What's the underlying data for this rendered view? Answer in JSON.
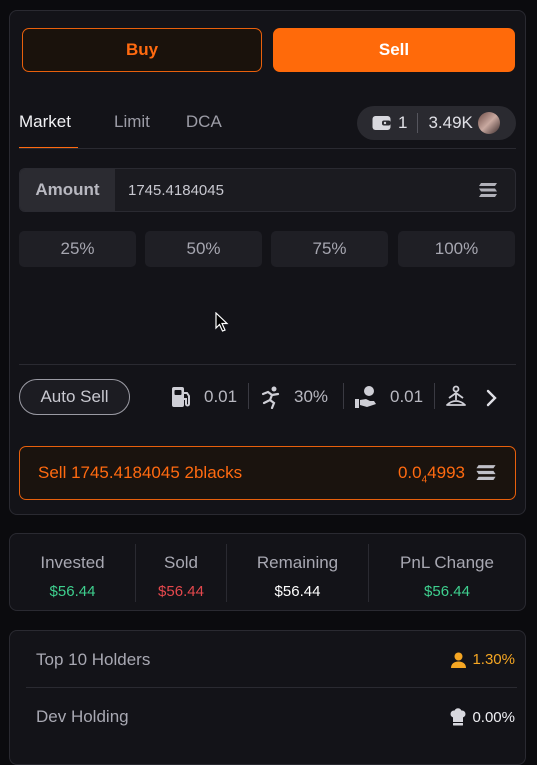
{
  "trade": {
    "buy_label": "Buy",
    "sell_label": "Sell",
    "tabs": [
      "Market",
      "Limit",
      "DCA"
    ],
    "wallet": {
      "count": "1",
      "balance": "3.49K"
    },
    "amount": {
      "label": "Amount",
      "value": "1745.4184045"
    },
    "percents": [
      "25%",
      "50%",
      "75%",
      "100%"
    ],
    "auto_sell_label": "Auto Sell",
    "settings": {
      "gas": "0.01",
      "slippage": "30%",
      "tip": "0.01"
    },
    "sell_bar": {
      "text": "Sell 1745.4184045 2blacks",
      "price_prefix": "0.0",
      "price_sub": "4",
      "price_suffix": "4993"
    }
  },
  "stats": {
    "invested": {
      "label": "Invested",
      "value": "$56.44"
    },
    "sold": {
      "label": "Sold",
      "value": "$56.44"
    },
    "remaining": {
      "label": "Remaining",
      "value": "$56.44"
    },
    "pnl": {
      "label": "PnL Change",
      "value": "$56.44"
    }
  },
  "holders": {
    "top10": {
      "label": "Top 10 Holders",
      "value": "1.30%"
    },
    "dev": {
      "label": "Dev Holding",
      "value": "0.00%"
    }
  },
  "colors": {
    "accent": "#ff6a10",
    "green": "#3ecf8e",
    "red": "#e5484d",
    "amber": "#f5a623"
  },
  "icons": [
    "wallet-icon",
    "avatar-icon",
    "solana-icon",
    "gas-pump-icon",
    "running-figure-icon",
    "hand-coin-icon",
    "meditation-figure-icon",
    "chevron-right-icon",
    "user-icon",
    "chef-hat-icon",
    "mouse-cursor-icon"
  ]
}
